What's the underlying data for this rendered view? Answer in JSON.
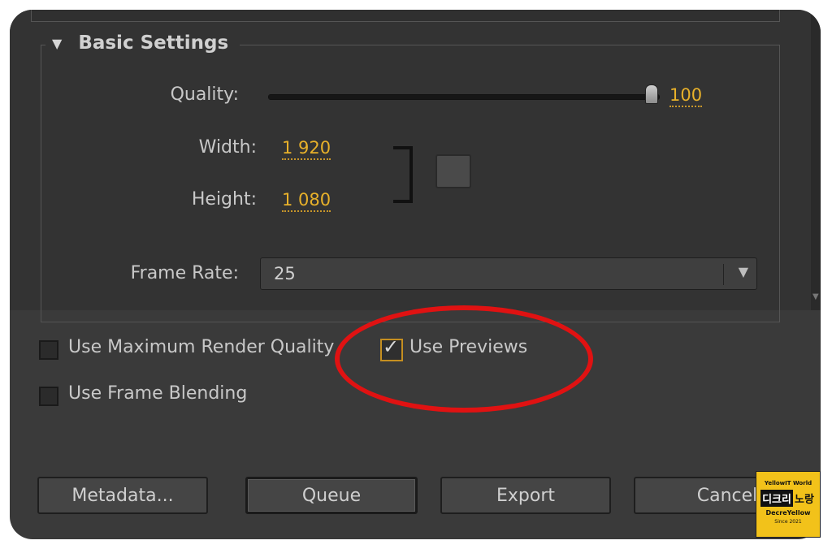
{
  "basic_settings": {
    "title": "Basic Settings",
    "quality_label": "Quality:",
    "quality_value": "100",
    "quality_level": 100,
    "width_label": "Width:",
    "width_value": "1 920",
    "height_label": "Height:",
    "height_value": "1 080",
    "frame_rate_label": "Frame Rate:",
    "frame_rate_value": "25"
  },
  "options": {
    "max_render_quality": {
      "label": "Use Maximum Render Quality",
      "checked": false
    },
    "use_previews": {
      "label": "Use Previews",
      "checked": true
    },
    "frame_blending": {
      "label": "Use Frame Blending",
      "checked": false
    }
  },
  "buttons": {
    "metadata": "Metadata...",
    "queue": "Queue",
    "export": "Export",
    "cancel": "Cancel"
  },
  "watermark": {
    "top": "YellowIT World",
    "mid_a": "디크리",
    "mid_b": "노랑",
    "brand": "DecreYellow",
    "since": "Since 2021"
  },
  "colors": {
    "panel": "#3a3a3a",
    "value_accent": "#e8b12a",
    "annotation": "#e01212"
  }
}
